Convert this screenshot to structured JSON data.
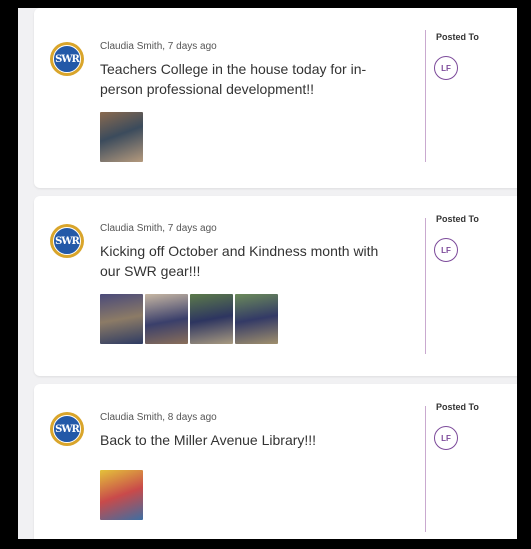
{
  "posts": [
    {
      "author_time": "Claudia Smith, 7 days ago",
      "message": "Teachers College in the house today for in-person professional development!!",
      "posted_to_label": "Posted To",
      "badge": "LF",
      "photos": [
        {
          "icon": "photo-thumbnail",
          "colors": [
            "#8a6a4f",
            "#3b4b5c",
            "#b59a7d"
          ]
        }
      ]
    },
    {
      "author_time": "Claudia Smith, 7 days ago",
      "message": "Kicking off October and Kindness month with our SWR gear!!!",
      "posted_to_label": "Posted To",
      "badge": "LF",
      "photos": [
        {
          "icon": "photo-thumbnail",
          "colors": [
            "#4a4a7a",
            "#8c7b66",
            "#2e3b63"
          ]
        },
        {
          "icon": "photo-thumbnail",
          "colors": [
            "#c7b7a3",
            "#3a3f6b",
            "#8a6f5a"
          ]
        },
        {
          "icon": "photo-thumbnail",
          "colors": [
            "#5c7a4a",
            "#2d3560",
            "#a89a80"
          ]
        },
        {
          "icon": "photo-thumbnail",
          "colors": [
            "#6b8a5a",
            "#333a66",
            "#a0906d"
          ]
        }
      ]
    },
    {
      "author_time": "Claudia Smith, 8 days ago",
      "message": "Back to the Miller Avenue Library!!!",
      "posted_to_label": "Posted To",
      "badge": "LF",
      "photos": [
        {
          "icon": "photo-thumbnail",
          "colors": [
            "#e4c23a",
            "#c94a4a",
            "#3d6ea3"
          ]
        }
      ]
    }
  ],
  "avatar_text": "SWR",
  "colors": {
    "accent": "#7c4a9a",
    "divider": "#c9a9cf",
    "avatar_ring": "#d9a52b",
    "avatar_inner": "#2359a8"
  }
}
